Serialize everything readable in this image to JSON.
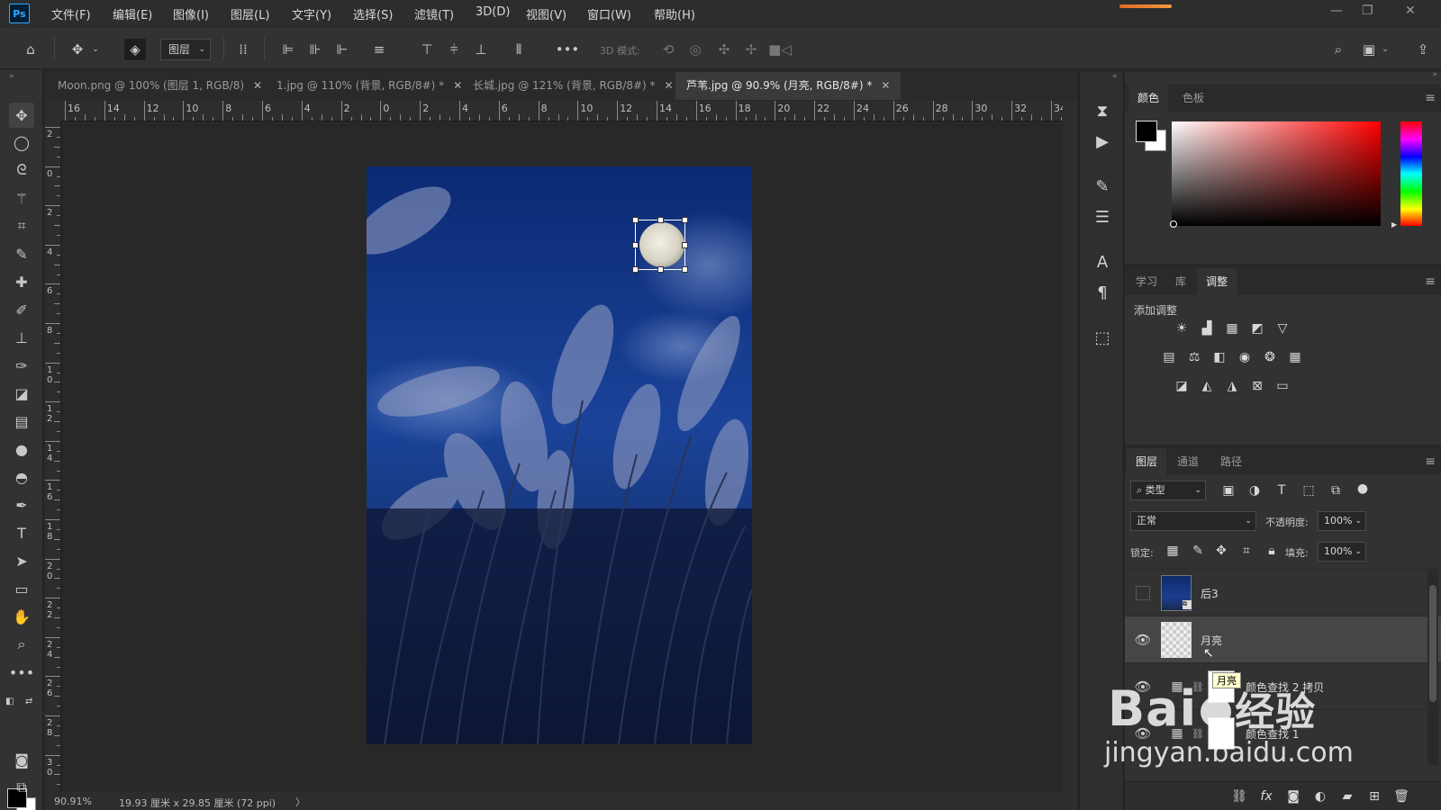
{
  "app": {
    "logo": "Ps"
  },
  "menu": [
    "文件(F)",
    "编辑(E)",
    "图像(I)",
    "图层(L)",
    "文字(Y)",
    "选择(S)",
    "滤镜(T)",
    "3D(D)",
    "视图(V)",
    "窗口(W)",
    "帮助(H)"
  ],
  "options": {
    "auto_select_target": "图层",
    "mode_3d_label": "3D 模式:"
  },
  "tabs": [
    {
      "title": "Moon.png @ 100% (图层 1, RGB/8)",
      "active": false
    },
    {
      "title": "1.jpg @ 110% (背景, RGB/8#) *",
      "active": false
    },
    {
      "title": "长城.jpg @ 121% (背景, RGB/8#) *",
      "active": false
    },
    {
      "title": "芦苇.jpg @ 90.9% (月亮, RGB/8#) *",
      "active": true
    }
  ],
  "ruler": {
    "h_labels": [
      "16",
      "14",
      "12",
      "10",
      "8",
      "6",
      "4",
      "2",
      "0",
      "2",
      "4",
      "6",
      "8",
      "10",
      "12",
      "14",
      "16",
      "18",
      "20",
      "22",
      "24",
      "26",
      "28",
      "30",
      "32",
      "34"
    ],
    "v_labels": [
      "2",
      "0",
      "2",
      "4",
      "6",
      "8",
      "1\n0",
      "1\n2",
      "1\n4",
      "1\n6",
      "1\n8",
      "2\n0",
      "2\n2",
      "2\n4",
      "2\n6",
      "2\n8",
      "3\n0"
    ]
  },
  "status": {
    "zoom": "90.91%",
    "doc_info": "19.93 厘米 x 29.85 厘米 (72 ppi)",
    "arrow": "〉"
  },
  "color_panel": {
    "tabs": [
      "颜色",
      "色板"
    ],
    "active": 0,
    "fg": "#000000",
    "bg": "#ffffff"
  },
  "adjust_panel": {
    "tabs": [
      "学习",
      "库",
      "调整"
    ],
    "active": 2,
    "heading": "添加调整"
  },
  "layers_panel": {
    "tabs": [
      "图层",
      "通道",
      "路径"
    ],
    "active": 0,
    "filter_kind": "类型",
    "blend_mode": "正常",
    "opacity_label": "不透明度:",
    "opacity": "100%",
    "lock_label": "锁定:",
    "fill_label": "填充:",
    "fill": "100%",
    "layers": [
      {
        "name": "后3",
        "visible": false,
        "selected": false,
        "kind": "image"
      },
      {
        "name": "月亮",
        "visible": true,
        "selected": true,
        "kind": "transparent"
      },
      {
        "name": "颜色查找 2 拷贝",
        "visible": true,
        "selected": false,
        "kind": "adjustment"
      },
      {
        "name": "颜色查找 1",
        "visible": true,
        "selected": false,
        "kind": "adjustment"
      }
    ],
    "tooltip": "月亮"
  },
  "watermark": {
    "brand": "Bai",
    "brand2": "经验",
    "url": "jingyan.baidu.com"
  },
  "colors": {
    "accent": "#31a8ff",
    "panel": "#323232",
    "dark": "#282828",
    "sky": "#1b3f8f"
  }
}
